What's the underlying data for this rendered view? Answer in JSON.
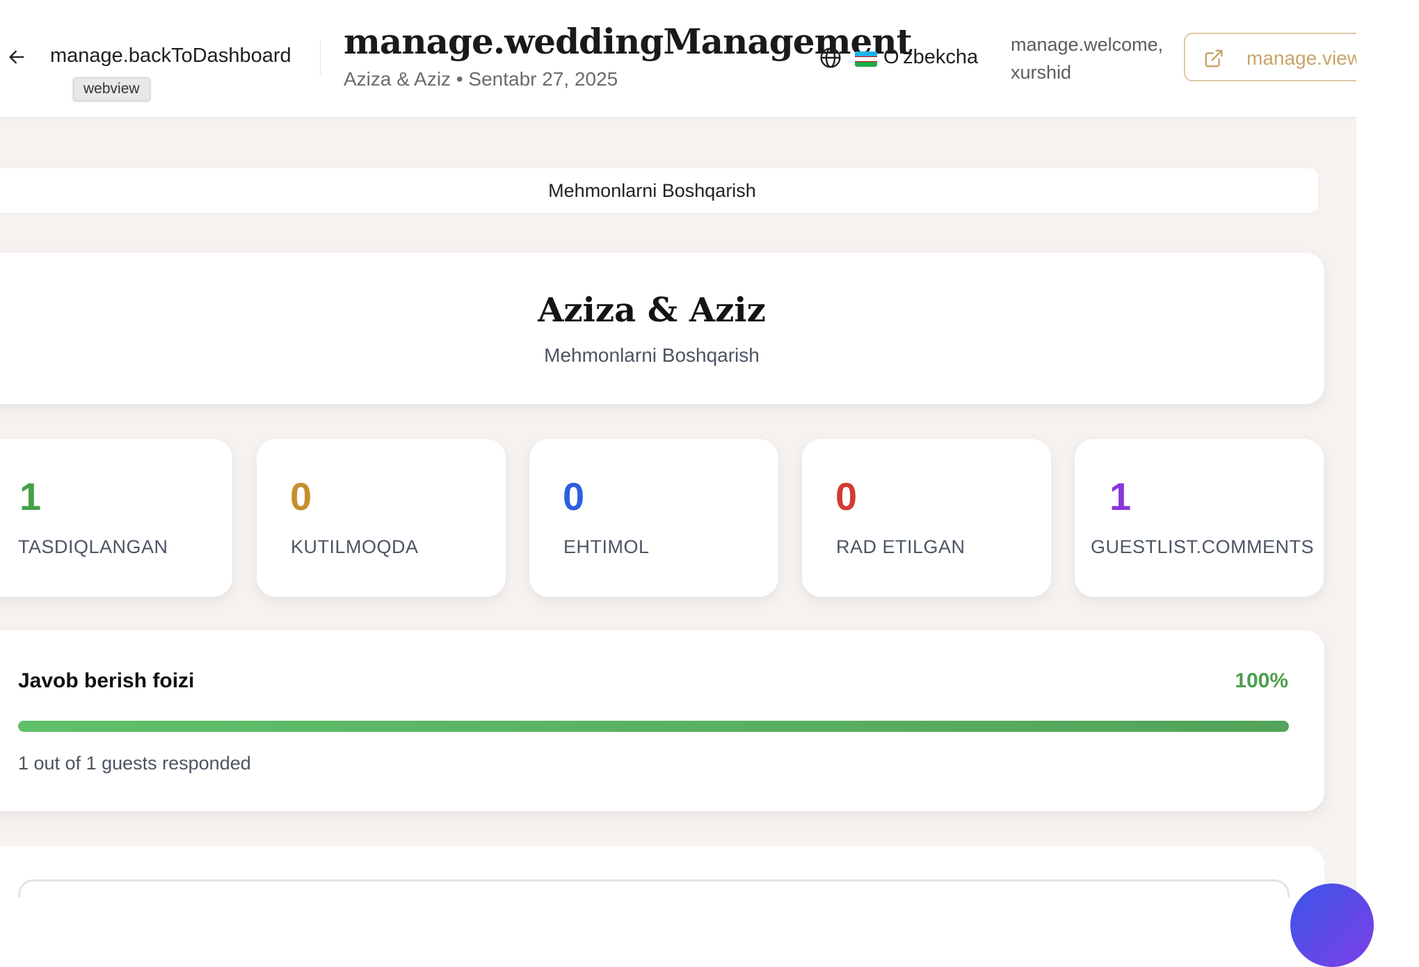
{
  "header": {
    "back_label": "manage.backToDashboard",
    "tooltip": "webview",
    "title": "manage.weddingManagement",
    "subtitle": "Aziza & Aziz • Sentabr 27, 2025",
    "language": "O'zbekcha",
    "welcome": "manage.welcome, xurshid",
    "view_site_label": "manage.viewSite",
    "icons": [
      "arrow-left-icon",
      "globe-icon",
      "uzbekistan-flag-icon",
      "external-link-icon"
    ]
  },
  "tabs": {
    "active_label": "Mehmonlarni Boshqarish"
  },
  "hero": {
    "couple": "Aziza & Aziz",
    "subtitle": "Mehmonlarni Boshqarish"
  },
  "stats": [
    {
      "value": "1",
      "label": "TASDIQLANGAN",
      "color": "#43a047"
    },
    {
      "value": "0",
      "label": "KUTILMOQDA",
      "color": "#c48f2c"
    },
    {
      "value": "0",
      "label": "EHTIMOL",
      "color": "#2f5fdd"
    },
    {
      "value": "0",
      "label": "RAD ETILGAN",
      "color": "#d23b32"
    },
    {
      "value": "1",
      "label": "GUESTLIST.COMMENTS",
      "color": "#8a35dd"
    }
  ],
  "response_rate": {
    "title": "Javob berish foizi",
    "percent_text": "100%",
    "percent": 100,
    "note": "1 out of 1 guests responded"
  }
}
